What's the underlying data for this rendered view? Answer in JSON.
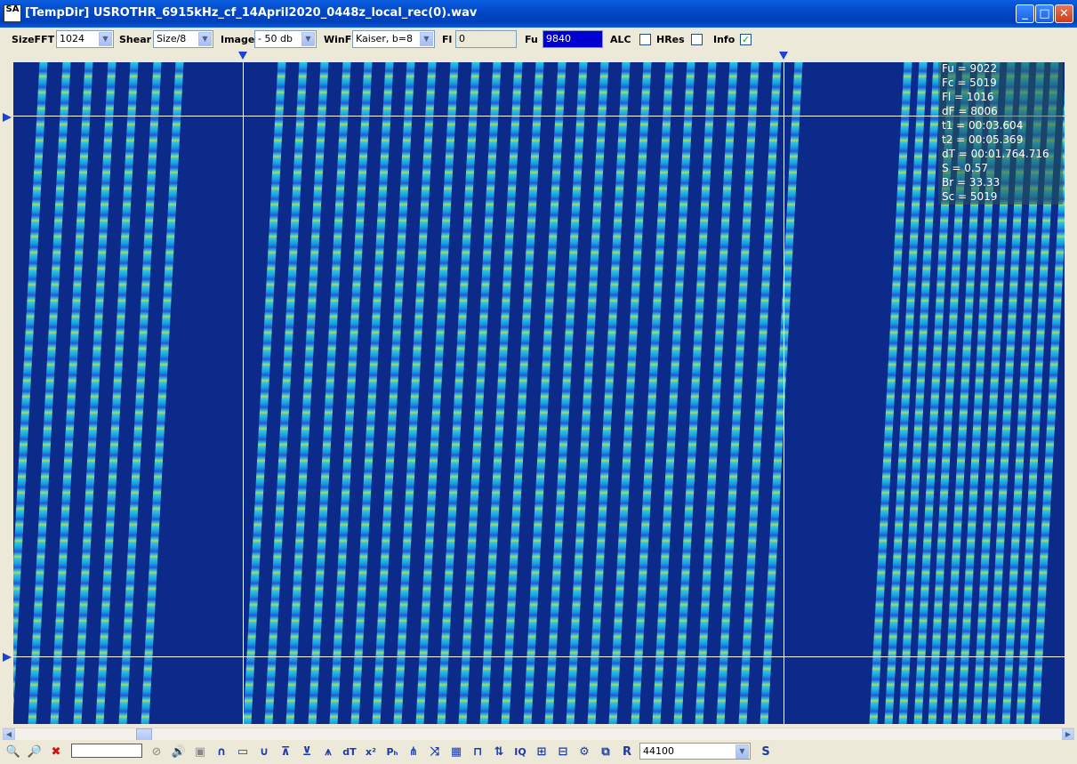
{
  "window": {
    "app_icon_text": "SA",
    "title": "[TempDir] USROTHR_6915kHz_cf_14April2020_0448z_local_rec(0).wav"
  },
  "toolbar": {
    "sizefft_label": "SizeFFT",
    "sizefft_value": "1024",
    "shear_label": "Shear",
    "shear_value": "Size/8",
    "image_label": "Image",
    "image_value": "- 50 db",
    "winf_label": "WinF",
    "winf_value": "Kaiser, b=8",
    "fl_label": "Fl",
    "fl_value": "0",
    "fu_label": "Fu",
    "fu_value": "9840",
    "alc_label": "ALC",
    "alc_checked": false,
    "hres_label": "HRes",
    "hres_checked": false,
    "info_label": "Info",
    "info_checked": true
  },
  "info_panel": [
    "Fu = 9022",
    "Fc = 5019",
    "Fl = 1016",
    "dF = 8006",
    "t1 = 00:03.604",
    "t2 = 00:05.369",
    "dT = 00:01.764.716",
    "S = 0.57",
    "Br = 33.33",
    "Sc = 5019"
  ],
  "bottom_toolbar": {
    "sample_rate": "44100",
    "icons": [
      "zoom-in-icon",
      "zoom-out-icon",
      "cancel-icon",
      "disabled-icon",
      "speaker-icon",
      "stop-icon",
      "arc-up-icon",
      "rect-icon",
      "arc-down-icon",
      "marker-a-icon",
      "marker-b-icon",
      "marker-c-icon",
      "dt-icon",
      "x-squared-icon",
      "ph-icon",
      "comb-icon",
      "shuffle-icon",
      "table-icon",
      "wave-icon",
      "arrows-updown-icon",
      "iq-icon",
      "pattern-a-icon",
      "pattern-b-icon",
      "gear-icon",
      "copy-icon",
      "r-icon"
    ],
    "s_label": "S"
  },
  "colors": {
    "titlebar": "#0248c8",
    "spectrogram_bg": "#0b2a8a",
    "marker": "#1d42d8",
    "fu_field_bg": "#0000d0"
  }
}
